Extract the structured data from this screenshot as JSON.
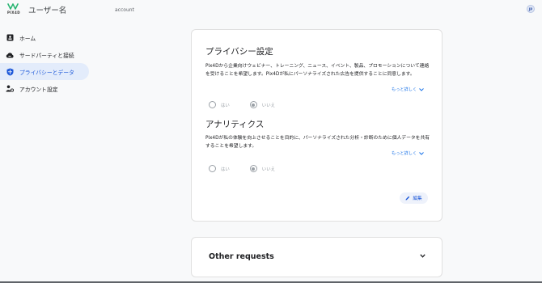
{
  "app": {
    "logo_text": "PIX4D",
    "username": "ユーザー名",
    "account_label": "account",
    "avatar_initials": "JP"
  },
  "sidebar": {
    "items": [
      {
        "label": "ホーム",
        "icon": "home-card-icon",
        "active": false
      },
      {
        "label": "サードパーティと接続",
        "icon": "cloud-icon",
        "active": false
      },
      {
        "label": "プライバシーとデータ",
        "icon": "shield-icon",
        "active": true
      },
      {
        "label": "アカウント設定",
        "icon": "account-settings-icon",
        "active": false
      }
    ]
  },
  "privacy": {
    "title": "プライバシー設定",
    "description": "Pix4Dから企業向けウェビナー、トレーニング、ニュース、イベント、製品、プロモーションについて連絡を受けることを希望します。Pix4Dが私にパーソナライズされた広告を提供することに同意します。",
    "more_label": "もっと詳しく",
    "yes_label": "はい",
    "no_label": "いいえ",
    "selected": "no"
  },
  "analytics": {
    "title": "アナリティクス",
    "description": "Pix4Dが私の体験を向上させることを目的に、パーソナライズされた分析・診断のために個人データを共有することを希望します。",
    "more_label": "もっと詳しく",
    "yes_label": "はい",
    "no_label": "いいえ",
    "selected": "no"
  },
  "edit_label": "編集",
  "other_requests": {
    "title": "Other requests"
  },
  "colors": {
    "accent": "#1a73e8",
    "active_nav_bg": "#e3ecfb",
    "logo_green": "#2bb673"
  }
}
